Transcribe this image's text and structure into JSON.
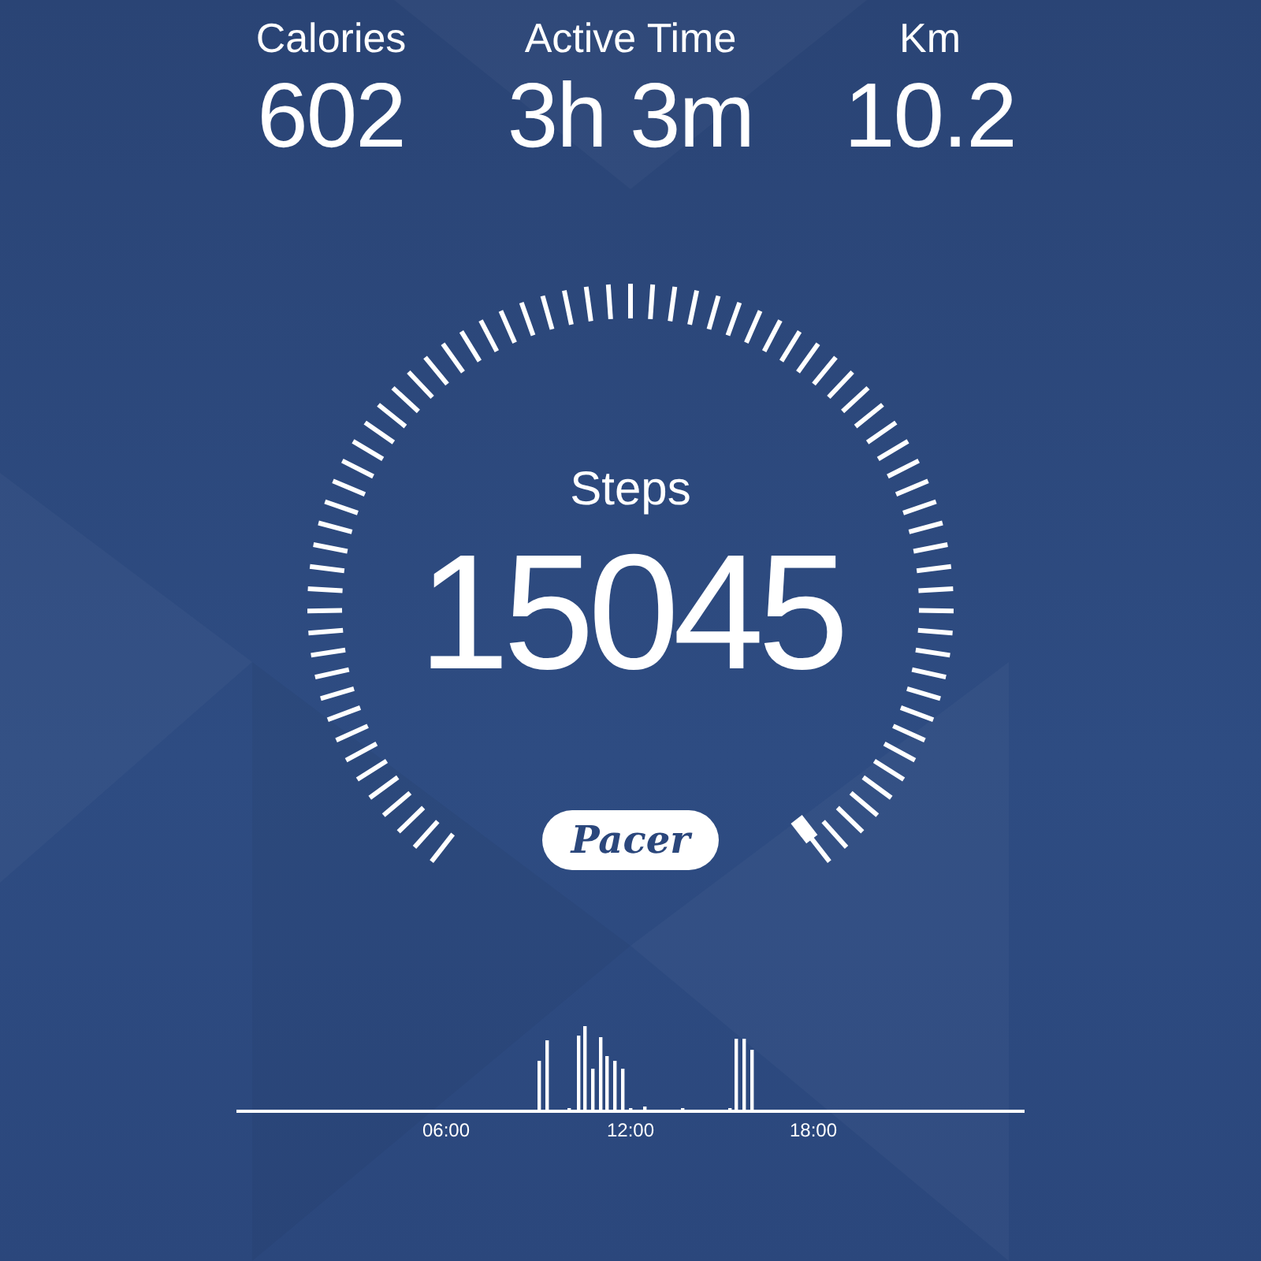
{
  "stats": [
    {
      "label": "Calories",
      "value": "602"
    },
    {
      "label": "Active Time",
      "value": "3h 3m"
    },
    {
      "label": "Km",
      "value": "10.2"
    }
  ],
  "gauge": {
    "label": "Steps",
    "value": "15045"
  },
  "badge": "Pacer",
  "activity": {
    "axis_labels": [
      "06:00",
      "12:00",
      "18:00"
    ]
  }
}
